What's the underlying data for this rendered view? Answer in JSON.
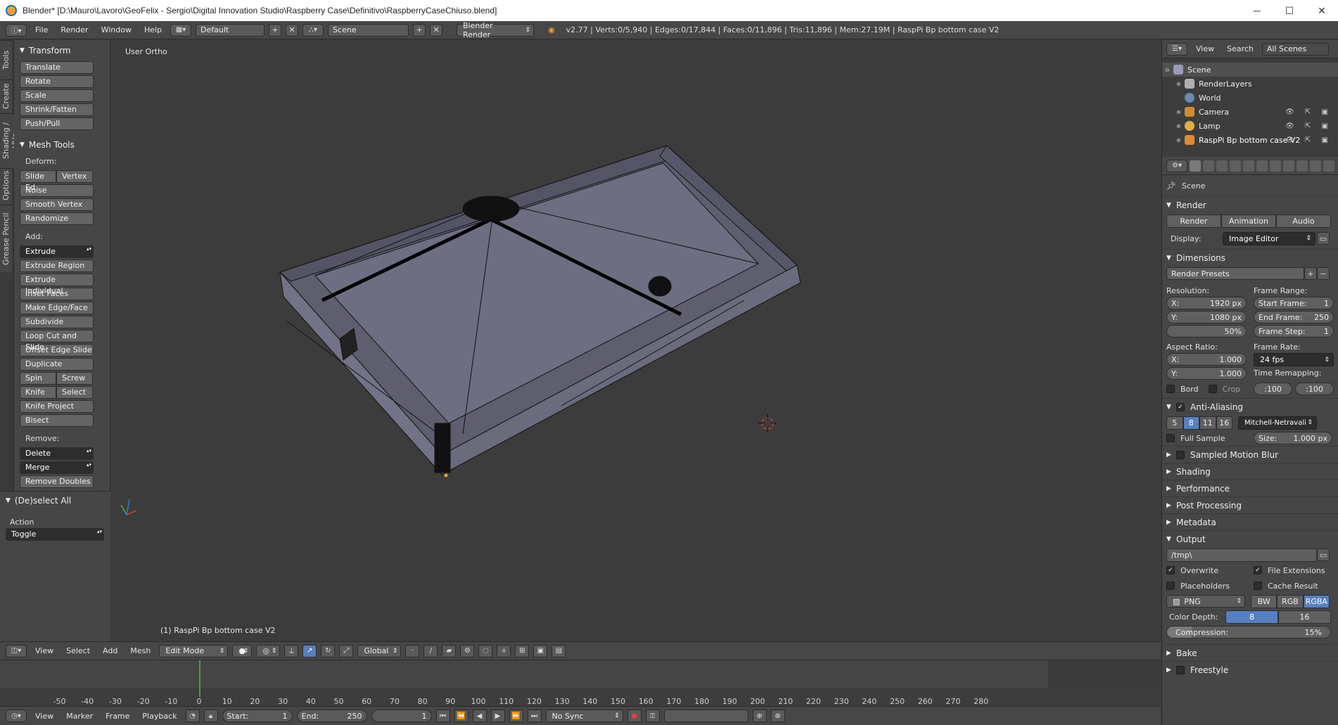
{
  "window": {
    "title": "Blender* [D:\\Mauro\\Lavoro\\GeoFelix - Sergio\\Digital Innovation Studio\\Raspberry Case\\Definitivo\\RaspberryCaseChiuso.blend]",
    "minimize": "─",
    "maximize": "☐",
    "close": "✕"
  },
  "info_header": {
    "menus": [
      "File",
      "Render",
      "Window",
      "Help"
    ],
    "layout": "Default",
    "scene": "Scene",
    "engine": "Blender Render",
    "stats": "v2.77 | Verts:0/5,940 | Edges:0/17,844 | Faces:0/11,896 | Tris:11,896 | Mem:27.19M | RaspPi Bp bottom case V2"
  },
  "tool_tabs": [
    "Tools",
    "Create",
    "Shading / UVs",
    "Options",
    "Grease Pencil"
  ],
  "toolshelf": {
    "transform": {
      "title": "Transform",
      "items": [
        "Translate",
        "Rotate",
        "Scale",
        "Shrink/Fatten",
        "Push/Pull"
      ]
    },
    "mesh_tools": {
      "title": "Mesh Tools",
      "deform_label": "Deform:",
      "slide_edge": "Slide Ed",
      "vertex": "Vertex",
      "deform_items": [
        "Noise",
        "Smooth Vertex",
        "Randomize"
      ],
      "add_label": "Add:",
      "extrude": "Extrude",
      "add_items": [
        "Extrude Region",
        "Extrude Individual",
        "Inset Faces",
        "Make Edge/Face",
        "Subdivide",
        "Loop Cut and Slide",
        "Offset Edge Slide",
        "Duplicate"
      ],
      "spin": "Spin",
      "screw": "Screw",
      "knife": "Knife",
      "select": "Select",
      "knife_project": "Knife Project",
      "bisect": "Bisect",
      "remove_label": "Remove:",
      "delete": "Delete",
      "merge": "Merge",
      "remove_doubles": "Remove Doubles"
    }
  },
  "operator_panel": {
    "title": "(De)select All",
    "action_label": "Action",
    "action_value": "Toggle"
  },
  "viewport": {
    "view_label": "User Ortho",
    "object_label": "(1) RaspPi Bp bottom case V2"
  },
  "view3d_header": {
    "menus": [
      "View",
      "Select",
      "Add",
      "Mesh"
    ],
    "mode": "Edit Mode",
    "orientation": "Global"
  },
  "timeline": {
    "ticks": [
      -50,
      -40,
      -30,
      -20,
      -10,
      0,
      10,
      20,
      30,
      40,
      50,
      60,
      70,
      80,
      90,
      100,
      110,
      120,
      130,
      140,
      150,
      160,
      170,
      180,
      190,
      200,
      210,
      220,
      230,
      240,
      250,
      260,
      270,
      280
    ],
    "current_frame": 1
  },
  "timeline_header": {
    "menus": [
      "View",
      "Marker",
      "Frame",
      "Playback"
    ],
    "start_label": "Start:",
    "start_value": "1",
    "end_label": "End:",
    "end_value": "250",
    "current": "1",
    "sync": "No Sync"
  },
  "outliner": {
    "view": "View",
    "search": "Search",
    "filter": "All Scenes",
    "rows": [
      {
        "label": "Scene"
      },
      {
        "label": "RenderLayers"
      },
      {
        "label": "World"
      },
      {
        "label": "Camera"
      },
      {
        "label": "Lamp"
      },
      {
        "label": "RaspPi Bp bottom case V2"
      }
    ]
  },
  "properties": {
    "breadcrumb": "Scene",
    "render": {
      "title": "Render",
      "buttons": [
        "Render",
        "Animation",
        "Audio"
      ],
      "display_label": "Display:",
      "display_value": "Image Editor"
    },
    "dimensions": {
      "title": "Dimensions",
      "presets": "Render Presets",
      "resolution_label": "Resolution:",
      "res_x": "1920 px",
      "res_y": "1080 px",
      "res_pct": "50%",
      "frame_range_label": "Frame Range:",
      "start_frame": "Start Frame:",
      "start_frame_v": "1",
      "end_frame": "End Frame:",
      "end_frame_v": "250",
      "frame_step": "Frame Step:",
      "frame_step_v": "1",
      "aspect_label": "Aspect Ratio:",
      "aspect_x": "1.000",
      "aspect_y": "1.000",
      "frame_rate_label": "Frame Rate:",
      "frame_rate": "24 fps",
      "time_remap_label": "Time Remapping:",
      "remap_old": ":100",
      "remap_new": ":100",
      "bord": "Bord",
      "crop": "Crop",
      "x_label": "X:",
      "y_label": "Y:"
    },
    "antialiasing": {
      "title": "Anti-Aliasing",
      "samples": [
        "5",
        "8",
        "11",
        "16"
      ],
      "filter": "Mitchell-Netravali",
      "full_sample": "Full Sample",
      "size_label": "Size:",
      "size_value": "1.000 px"
    },
    "collapsed": [
      "Sampled Motion Blur",
      "Shading",
      "Performance",
      "Post Processing",
      "Metadata"
    ],
    "output": {
      "title": "Output",
      "path": "/tmp\\",
      "overwrite": "Overwrite",
      "file_ext": "File Extensions",
      "placeholders": "Placeholders",
      "cache_result": "Cache Result",
      "format": "PNG",
      "color_modes": [
        "BW",
        "RGB",
        "RGBA"
      ],
      "depth_label": "Color Depth:",
      "depths": [
        "8",
        "16"
      ],
      "compression_label": "Compression:",
      "compression_value": "15%",
      "compression_level": 0.15
    },
    "bake": "Bake",
    "freestyle": "Freestyle"
  },
  "colors": {
    "accent_blue": "#5680c2",
    "playhead_green": "#3fa34d",
    "mesh_fill": "#6a6a7c"
  }
}
